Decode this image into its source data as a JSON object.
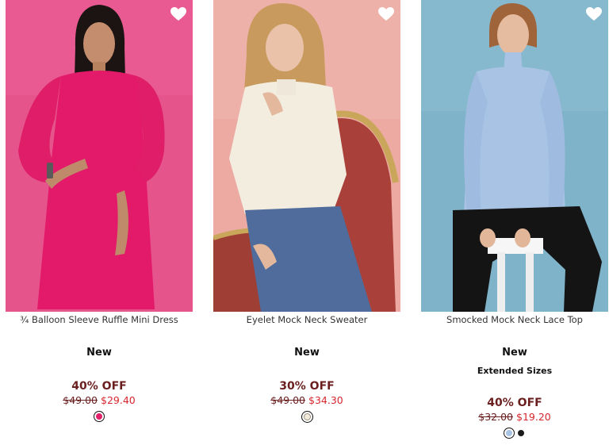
{
  "products": [
    {
      "name": "¾ Balloon Sleeve Ruffle Mini Dress",
      "badge": "New",
      "discount": "40% OFF",
      "original_price": "$49.00",
      "sale_price": "$29.40",
      "swatch_colors": [
        "#e0216a"
      ],
      "photo_icon": "model-pink-dress-photo",
      "wishlist_icon": "heart-icon"
    },
    {
      "name": "Eyelet Mock Neck Sweater",
      "badge": "New",
      "discount": "30% OFF",
      "original_price": "$49.00",
      "sale_price": "$34.30",
      "swatch_colors": [
        "#f3ecdc"
      ],
      "photo_icon": "model-ivory-sweater-photo",
      "wishlist_icon": "heart-icon"
    },
    {
      "name": "Smocked Mock Neck Lace Top",
      "badge": "New",
      "secondary_badge": "Extended Sizes",
      "discount": "40% OFF",
      "original_price": "$32.00",
      "sale_price": "$19.20",
      "swatch_colors": [
        "#a9c3e4",
        "#1a1a1a"
      ],
      "photo_icon": "model-blue-lace-top-photo",
      "wishlist_icon": "heart-icon"
    }
  ]
}
